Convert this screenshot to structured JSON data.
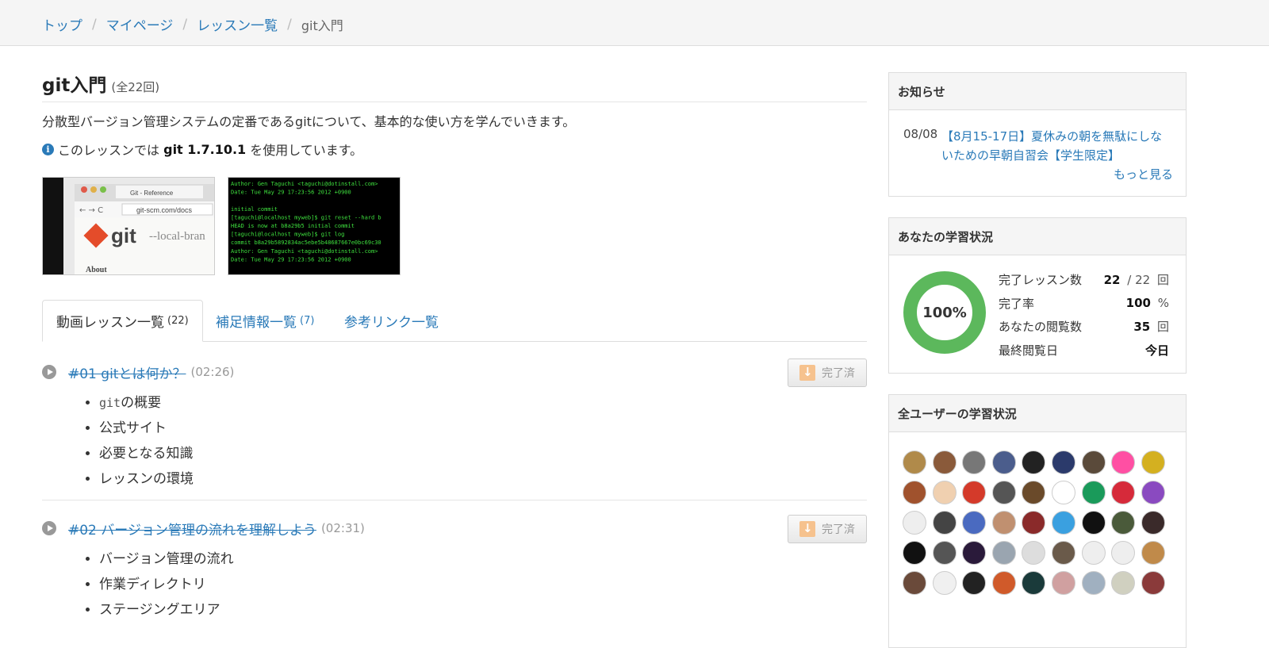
{
  "breadcrumb": [
    "トップ",
    "マイページ",
    "レッスン一覧",
    "git入門"
  ],
  "lesson_set": {
    "title": "git入門",
    "count": "(全22回)",
    "description": "分散型バージョン管理システムの定番であるgitについて、基本的な使い方を学んでいきます。",
    "info_prefix": "このレッスンでは",
    "info_version": "git 1.7.10.1",
    "info_suffix": "を使用しています。"
  },
  "thumb1": {
    "tab_title": "Git - Reference",
    "url": "git-scm.com/docs",
    "logo": "git",
    "tagline": "--local-bran",
    "about": "About"
  },
  "thumb2": {
    "lines": [
      "Author: Gen Taguchi <taguchi@dotinstall.com>",
      "Date:   Tue May 29 17:23:56 2012 +0900",
      "",
      "    initial commit",
      "[taguchi@localhost myweb]$ git reset --hard b",
      "HEAD is now at b8a29b5 initial commit",
      "[taguchi@localhost myweb]$ git log",
      "commit b8a29b5892834ac5ebe5b48687667e0bc69c30",
      "Author: Gen Taguchi <taguchi@dotinstall.com>",
      "Date:   Tue May 29 17:23:56 2012 +0900"
    ]
  },
  "tabs": [
    {
      "label": "動画レッスン一覧",
      "count": "(22)"
    },
    {
      "label": "補足情報一覧",
      "count": "(7)"
    },
    {
      "label": "参考リンク一覧",
      "count": ""
    }
  ],
  "lessons": [
    {
      "title": "#01 gitとは何か？",
      "duration": "(02:26)",
      "button": "完了済",
      "topics_mono": "git",
      "topic0_rest": "の概要",
      "topics": [
        "公式サイト",
        "必要となる知識",
        "レッスンの環境"
      ]
    },
    {
      "title": "#02 バージョン管理の流れを理解しよう",
      "duration": "(02:31)",
      "button": "完了済",
      "topics": [
        "バージョン管理の流れ",
        "作業ディレクトリ",
        "ステージングエリア"
      ]
    }
  ],
  "news": {
    "header": "お知らせ",
    "date": "08/08",
    "text": "【8月15-17日】夏休みの朝を無駄にしないための早朝自習会【学生限定】",
    "more": "もっと見る"
  },
  "my_stats": {
    "header": "あなたの学習状況",
    "percent_label": "100%",
    "completion": 1.0,
    "rows": [
      {
        "label": "完了レッスン数",
        "value": "22",
        "extra": "/ 22",
        "unit": "回"
      },
      {
        "label": "完了率",
        "value": "100",
        "extra": "",
        "unit": "%"
      },
      {
        "label": "あなたの閲覧数",
        "value": "35",
        "extra": "",
        "unit": "回"
      },
      {
        "label": "最終閲覧日",
        "value": "今日",
        "extra": "",
        "unit": ""
      }
    ]
  },
  "all_users": {
    "header": "全ユーザーの学習状況",
    "avatar_colors": [
      "#b08a4a",
      "#8a5a3a",
      "#777",
      "#4b5d8c",
      "#222",
      "#2b3a6b",
      "#5a4a3a",
      "#ff4fa3",
      "#d4b020",
      "#a0522d",
      "#f0d0b0",
      "#d43a2a",
      "#555",
      "#6a4a2a",
      "#ffffff",
      "#1a9a5a",
      "#d62a3a",
      "#8a4ac0",
      "#eeeeee",
      "#444",
      "#4a6ac0",
      "#c09070",
      "#8a2a2a",
      "#3aa0e0",
      "#111",
      "#4a5a3a",
      "#3a2a2a",
      "#111",
      "#555",
      "#2a1a3a",
      "#9aa5b0",
      "#dddddd",
      "#6a5a4a",
      "#eeeeee",
      "#eeeeee",
      "#c08a4a",
      "#6a4a3a",
      "#f0f0f0",
      "#222",
      "#d05a2a",
      "#1a3a3a",
      "#d0a0a0",
      "#a0b0c0",
      "#d0d0c0",
      "#8a3a3a"
    ]
  }
}
